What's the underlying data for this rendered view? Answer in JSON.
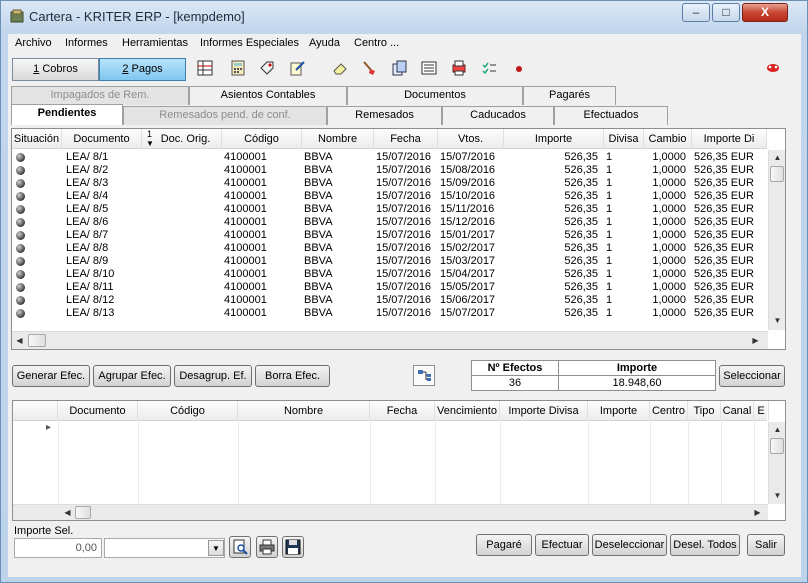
{
  "window": {
    "title": "Cartera - KRITER ERP - [kempdemo]",
    "controls": {
      "minimize": "–",
      "maximize": "□",
      "close": "X"
    }
  },
  "menu": [
    "Archivo",
    "Informes",
    "Herramientas",
    "Informes Especiales",
    "Ayuda",
    "Centro ..."
  ],
  "mode_buttons": [
    {
      "key": "1",
      "label": " Cobros",
      "active": false
    },
    {
      "key": "2",
      "label": " Pagos",
      "active": true
    }
  ],
  "toolbar_icons": [
    "grid-report-icon",
    "calculator-icon",
    "tag-icon",
    "edit-note-icon",
    "eraser-icon",
    "brush-icon",
    "cards-icon",
    "list-icon",
    "printer-stack-icon",
    "checklist-icon",
    "red-dot-icon",
    "help-bug-icon"
  ],
  "tabs_row1": [
    {
      "label": "Impagados de Rem.",
      "disabled": true
    },
    {
      "label": "Asientos Contables",
      "disabled": false
    },
    {
      "label": "Documentos",
      "disabled": false
    },
    {
      "label": "Pagarés",
      "disabled": false
    }
  ],
  "tabs_row2": [
    {
      "label": "Pendientes",
      "selected": true,
      "disabled": false
    },
    {
      "label": "Remesados pend. de conf.",
      "selected": false,
      "disabled": true
    },
    {
      "label": "Remesados",
      "selected": false,
      "disabled": false
    },
    {
      "label": "Caducados",
      "selected": false,
      "disabled": false
    },
    {
      "label": "Efectuados",
      "selected": false,
      "disabled": false
    }
  ],
  "main_grid": {
    "sort_indicator": "1",
    "columns": [
      "Situación",
      "Documento",
      "Doc. Orig.",
      "Código",
      "Nombre",
      "Fecha",
      "Vtos.",
      "Importe",
      "Divisa",
      "Cambio",
      "Importe Di"
    ],
    "rows": [
      [
        "LEA/ 8/1",
        "",
        "4100001",
        "BBVA",
        "15/07/2016",
        "15/07/2016",
        "526,35",
        "1",
        "1,0000",
        "526,35 EUR"
      ],
      [
        "LEA/ 8/2",
        "",
        "4100001",
        "BBVA",
        "15/07/2016",
        "15/08/2016",
        "526,35",
        "1",
        "1,0000",
        "526,35 EUR"
      ],
      [
        "LEA/ 8/3",
        "",
        "4100001",
        "BBVA",
        "15/07/2016",
        "15/09/2016",
        "526,35",
        "1",
        "1,0000",
        "526,35 EUR"
      ],
      [
        "LEA/ 8/4",
        "",
        "4100001",
        "BBVA",
        "15/07/2016",
        "15/10/2016",
        "526,35",
        "1",
        "1,0000",
        "526,35 EUR"
      ],
      [
        "LEA/ 8/5",
        "",
        "4100001",
        "BBVA",
        "15/07/2016",
        "15/11/2016",
        "526,35",
        "1",
        "1,0000",
        "526,35 EUR"
      ],
      [
        "LEA/ 8/6",
        "",
        "4100001",
        "BBVA",
        "15/07/2016",
        "15/12/2016",
        "526,35",
        "1",
        "1,0000",
        "526,35 EUR"
      ],
      [
        "LEA/ 8/7",
        "",
        "4100001",
        "BBVA",
        "15/07/2016",
        "15/01/2017",
        "526,35",
        "1",
        "1,0000",
        "526,35 EUR"
      ],
      [
        "LEA/ 8/8",
        "",
        "4100001",
        "BBVA",
        "15/07/2016",
        "15/02/2017",
        "526,35",
        "1",
        "1,0000",
        "526,35 EUR"
      ],
      [
        "LEA/ 8/9",
        "",
        "4100001",
        "BBVA",
        "15/07/2016",
        "15/03/2017",
        "526,35",
        "1",
        "1,0000",
        "526,35 EUR"
      ],
      [
        "LEA/ 8/10",
        "",
        "4100001",
        "BBVA",
        "15/07/2016",
        "15/04/2017",
        "526,35",
        "1",
        "1,0000",
        "526,35 EUR"
      ],
      [
        "LEA/ 8/11",
        "",
        "4100001",
        "BBVA",
        "15/07/2016",
        "15/05/2017",
        "526,35",
        "1",
        "1,0000",
        "526,35 EUR"
      ],
      [
        "LEA/ 8/12",
        "",
        "4100001",
        "BBVA",
        "15/07/2016",
        "15/06/2017",
        "526,35",
        "1",
        "1,0000",
        "526,35 EUR"
      ],
      [
        "LEA/ 8/13",
        "",
        "4100001",
        "BBVA",
        "15/07/2016",
        "15/07/2017",
        "526,35",
        "1",
        "1,0000",
        "526,35 EUR"
      ]
    ]
  },
  "actions": [
    {
      "label": "Generar Efec.",
      "u": "G"
    },
    {
      "label": "Agrupar Efec.",
      "u": "A"
    },
    {
      "label": "Desagrup. Ef.",
      "u": "D"
    },
    {
      "label": "Borra Efec.",
      "u": "B"
    }
  ],
  "summary": {
    "efectos_header": "Nº Efectos",
    "importe_header": "Importe",
    "efectos_value": "36",
    "importe_value": "18.948,60"
  },
  "select_button": "Seleccionar",
  "lower_grid": {
    "columns": [
      "Documento",
      "Código",
      "Nombre",
      "Fecha",
      "Vencimiento",
      "Importe Divisa",
      "Importe",
      "Centro",
      "Tipo",
      "Canal",
      "E"
    ],
    "row_marker": "▸"
  },
  "footer": {
    "importe_sel_label": "Importe Sel.",
    "importe_sel_value": "0,00",
    "combo_value": "",
    "buttons": [
      "Pagaré",
      "Efectuar",
      "Deseleccionar",
      "Desel. Todos",
      "Salir"
    ]
  }
}
